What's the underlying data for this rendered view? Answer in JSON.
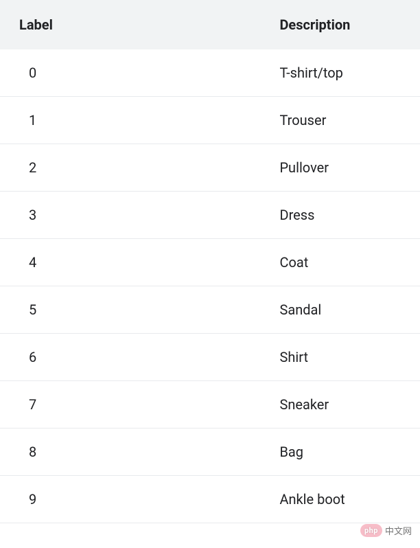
{
  "table": {
    "headers": {
      "label": "Label",
      "description": "Description"
    },
    "rows": [
      {
        "label": "0",
        "description": "T-shirt/top"
      },
      {
        "label": "1",
        "description": "Trouser"
      },
      {
        "label": "2",
        "description": "Pullover"
      },
      {
        "label": "3",
        "description": "Dress"
      },
      {
        "label": "4",
        "description": "Coat"
      },
      {
        "label": "5",
        "description": "Sandal"
      },
      {
        "label": "6",
        "description": "Shirt"
      },
      {
        "label": "7",
        "description": "Sneaker"
      },
      {
        "label": "8",
        "description": "Bag"
      },
      {
        "label": "9",
        "description": "Ankle boot"
      }
    ]
  },
  "watermark": {
    "badge": "php",
    "text": "中文网"
  }
}
